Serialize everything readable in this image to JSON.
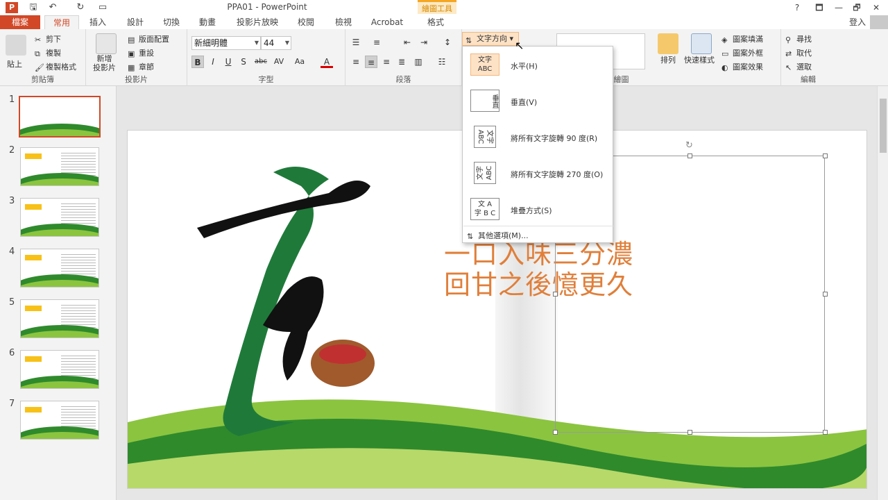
{
  "window": {
    "title": "PPA01 - PowerPoint",
    "tool_context": "繪圖工具",
    "app_icon": "P",
    "help": "?",
    "controls": [
      "🗖",
      "—",
      "🗗",
      "✕"
    ]
  },
  "qat": [
    "save-icon",
    "undo-icon",
    "redo-icon",
    "start-from-beginning-icon"
  ],
  "tabs": [
    {
      "label": "檔案"
    },
    {
      "label": "常用"
    },
    {
      "label": "插入"
    },
    {
      "label": "設計"
    },
    {
      "label": "切換"
    },
    {
      "label": "動畫"
    },
    {
      "label": "投影片放映"
    },
    {
      "label": "校閱"
    },
    {
      "label": "檢視"
    },
    {
      "label": "Acrobat"
    },
    {
      "label": "格式"
    }
  ],
  "signin": "登入",
  "ribbon": {
    "clipboard": {
      "label": "剪貼簿",
      "paste": "貼上",
      "cut": "剪下",
      "copy": "複製",
      "format_painter": "複製格式"
    },
    "slides": {
      "label": "投影片",
      "new_slide": "新增\n投影片",
      "layout": "版面配置",
      "reset": "重設",
      "section": "章節"
    },
    "font": {
      "label": "字型",
      "font_name": "新細明體",
      "font_size": "44",
      "bold": "B",
      "italic": "I",
      "underline": "U",
      "shadow": "S",
      "strike": "abc",
      "spacing": "AV",
      "case": "Aa",
      "color": "A"
    },
    "paragraph": {
      "label": "段落",
      "text_direction": "文字方向"
    },
    "drawing": {
      "label": "繪圖",
      "arrange": "排列",
      "quick_styles": "快速樣式",
      "fill": "圖案填滿",
      "outline": "圖案外框",
      "effects": "圖案效果"
    },
    "editing": {
      "label": "編輯",
      "find": "尋找",
      "replace": "取代",
      "select": "選取"
    }
  },
  "menu": {
    "items": [
      {
        "label": "水平(H)",
        "preview": "文字\nABC"
      },
      {
        "label": "垂直(V)",
        "preview": "垂直"
      },
      {
        "label": "將所有文字旋轉 90 度(R)",
        "preview": "文字\nABC"
      },
      {
        "label": "將所有文字旋轉 270 度(O)",
        "preview": "文字\nABC"
      },
      {
        "label": "堆疊方式(S)",
        "preview": "文 A\n字 B C"
      }
    ],
    "more": "其他選項(M)..."
  },
  "thumbnails": [
    "1",
    "2",
    "3",
    "4",
    "5",
    "6",
    "7"
  ],
  "slide": {
    "line1": "一口入味三分濃",
    "line2": "回甘之後憶更久"
  },
  "colors": {
    "accent": "#d24726",
    "text_orange": "#e07f3a",
    "green_dark": "#2f8a2c",
    "green_light": "#8bc43f"
  }
}
